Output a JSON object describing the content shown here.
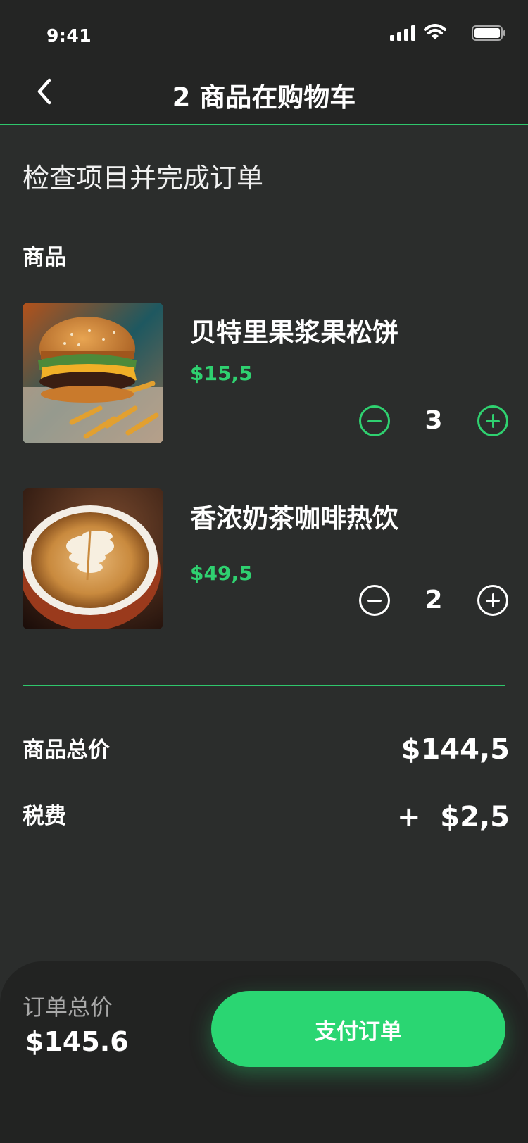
{
  "status": {
    "time": "9:41"
  },
  "nav": {
    "title": "2 商品在购物车"
  },
  "page": {
    "subtitle": "检查项目并完成订单",
    "section_label": "商品"
  },
  "items": [
    {
      "name": "贝特里果浆果松饼",
      "price": "$15,5",
      "quantity": "3",
      "icon": "burger-photo",
      "active": true
    },
    {
      "name": "香浓奶茶咖啡热饮",
      "price": "$49,5",
      "quantity": "2",
      "icon": "latte-photo",
      "active": false
    }
  ],
  "summary": {
    "subtotal_label": "商品总价",
    "subtotal_value": "$144,5",
    "tax_label": "税费",
    "tax_value": "+  $2,5"
  },
  "checkout": {
    "total_label": "订单总价",
    "total_value": "$145.6",
    "pay_label": "支付订单"
  },
  "colors": {
    "accent": "#2fd170",
    "background": "#2b2d2c",
    "header": "#242524"
  }
}
